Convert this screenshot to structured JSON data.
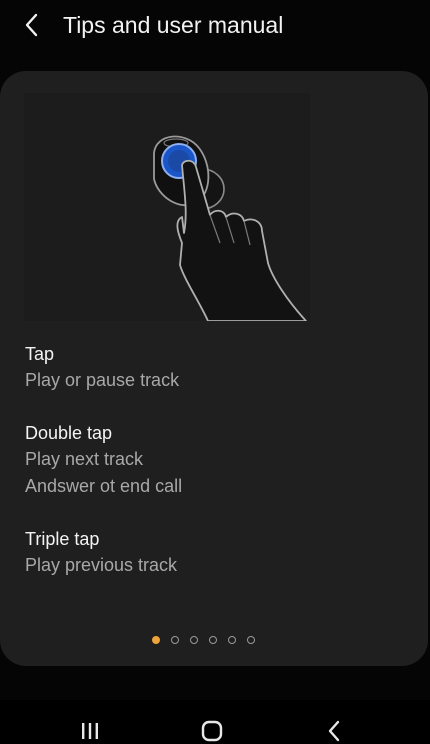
{
  "header": {
    "title": "Tips and user manual",
    "back_icon": "chevron-left-icon"
  },
  "illustration": {
    "icon": "finger-tap-earbud-icon",
    "accent_color": "#1a56c8"
  },
  "gestures": [
    {
      "title": "Tap",
      "lines": [
        "Play or pause track"
      ]
    },
    {
      "title": "Double tap",
      "lines": [
        "Play next track",
        "Andswer ot end call"
      ]
    },
    {
      "title": "Triple tap",
      "lines": [
        "Play previous track"
      ]
    }
  ],
  "pager": {
    "total": 6,
    "active_index": 0,
    "active_color": "#f0a33a"
  },
  "nav_bar": {
    "recent_icon": "recent-apps-icon",
    "home_icon": "home-icon",
    "back_icon": "back-icon"
  }
}
